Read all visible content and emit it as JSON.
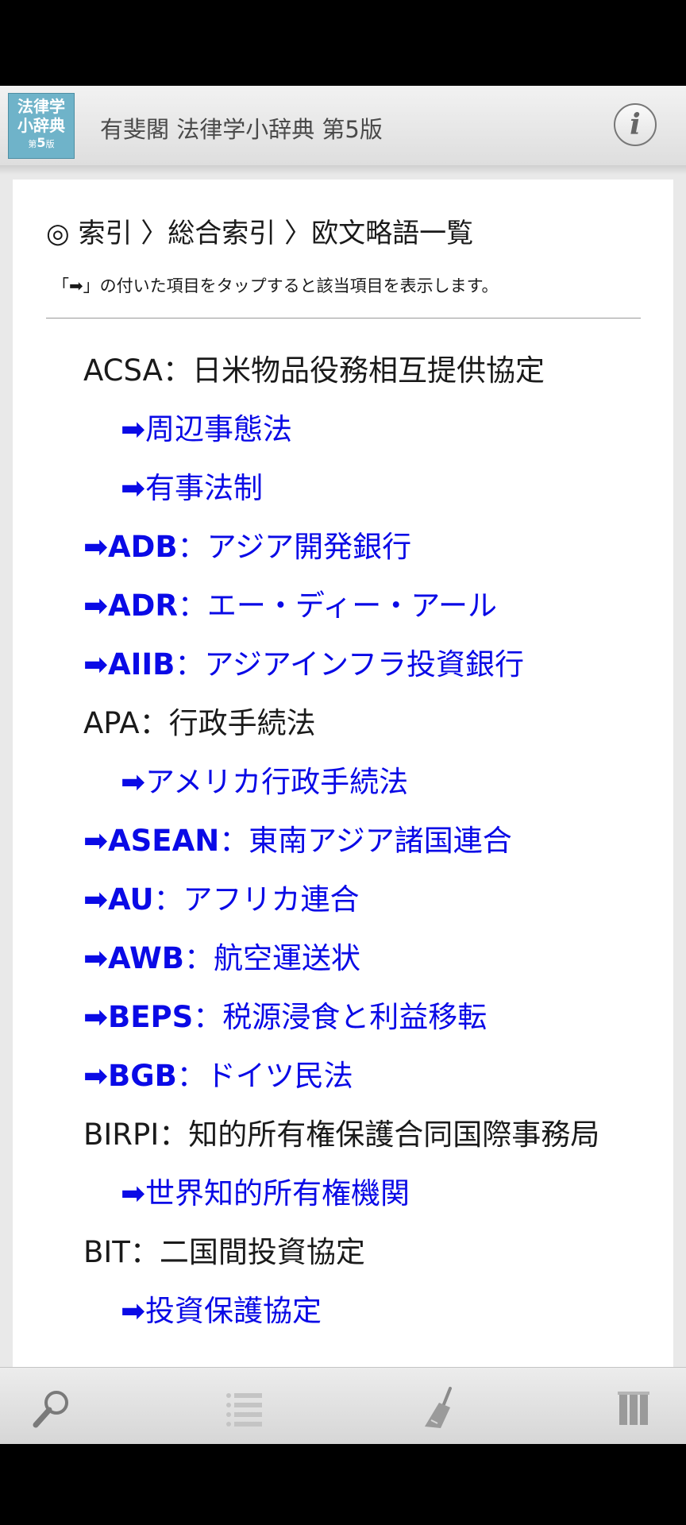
{
  "header": {
    "logo_line1": "法律学",
    "logo_line2": "小辞典",
    "logo_edition_prefix": "第",
    "logo_edition_num": "5",
    "logo_edition_suffix": "版",
    "title": "有斐閣 法律学小辞典 第5版",
    "info_label": "i"
  },
  "breadcrumb": "◎ 索引 〉総合索引 〉欧文略語一覧",
  "hint": "「➡」の付いた項目をタップすると該当項目を表示します。",
  "entries": [
    {
      "type": "head",
      "text": "ACSA：日米物品役務相互提供協定"
    },
    {
      "type": "sub",
      "arrow": "➡",
      "text": "周辺事態法"
    },
    {
      "type": "sub",
      "arrow": "➡",
      "text": "有事法制"
    },
    {
      "type": "link",
      "arrow": "➡",
      "abbr": "ADB",
      "text": "：アジア開発銀行"
    },
    {
      "type": "link",
      "arrow": "➡",
      "abbr": "ADR",
      "text": "：エー・ディー・アール"
    },
    {
      "type": "link",
      "arrow": "➡",
      "abbr": "AIIB",
      "text": "：アジアインフラ投資銀行"
    },
    {
      "type": "head",
      "text": "APA：行政手続法"
    },
    {
      "type": "sub",
      "arrow": "➡",
      "text": "アメリカ行政手続法"
    },
    {
      "type": "link",
      "arrow": "➡",
      "abbr": "ASEAN",
      "text": "：東南アジア諸国連合"
    },
    {
      "type": "link",
      "arrow": "➡",
      "abbr": "AU",
      "text": "：アフリカ連合"
    },
    {
      "type": "link",
      "arrow": "➡",
      "abbr": "AWB",
      "text": "：航空運送状"
    },
    {
      "type": "link",
      "arrow": "➡",
      "abbr": "BEPS",
      "text": "：税源浸食と利益移転"
    },
    {
      "type": "link",
      "arrow": "➡",
      "abbr": "BGB",
      "text": "：ドイツ民法"
    },
    {
      "type": "head",
      "text": "BIRPI：知的所有権保護合同国際事務局"
    },
    {
      "type": "sub",
      "arrow": "➡",
      "text": "世界知的所有権機関"
    },
    {
      "type": "head",
      "text": "BIT：二国間投資協定"
    },
    {
      "type": "sub",
      "arrow": "➡",
      "text": "投資保護協定"
    }
  ],
  "toolbar": {
    "icons": [
      "search-icon",
      "list-icon",
      "broom-icon",
      "columns-icon"
    ]
  },
  "colors": {
    "link": "#0a0ae6",
    "text": "#1a1a1a",
    "logo_bg": "#6fb3c9"
  }
}
